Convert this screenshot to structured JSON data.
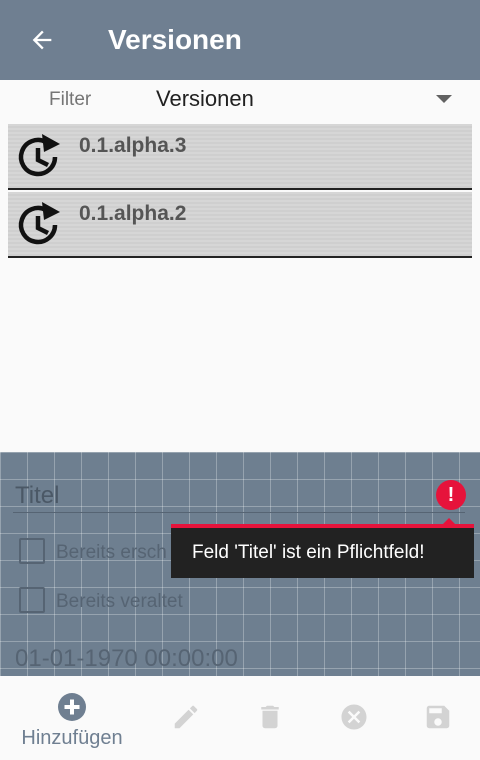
{
  "appbar": {
    "title": "Versionen",
    "back_icon": "arrow-left-icon"
  },
  "filter": {
    "label": "Filter",
    "selected": "Versionen"
  },
  "versions": [
    {
      "label": "0.1.alpha.3",
      "icon": "history-icon"
    },
    {
      "label": "0.1.alpha.2",
      "icon": "history-icon"
    }
  ],
  "form": {
    "title_placeholder": "Titel",
    "error_message": "Feld 'Titel' ist ein Pflichtfeld!",
    "checkbox_1_label": "Bereits ersch",
    "checkbox_2_label": "Bereits veraltet",
    "date_value": "01-01-1970 00:00:00"
  },
  "bottom_bar": {
    "add_label": "Hinzufügen",
    "icons": [
      "plus-circle-icon",
      "pencil-icon",
      "trash-icon",
      "cancel-circle-icon",
      "save-icon"
    ]
  },
  "colors": {
    "appbar": "#6f7f91",
    "error": "#e6133b",
    "tooltip": "#222222"
  }
}
